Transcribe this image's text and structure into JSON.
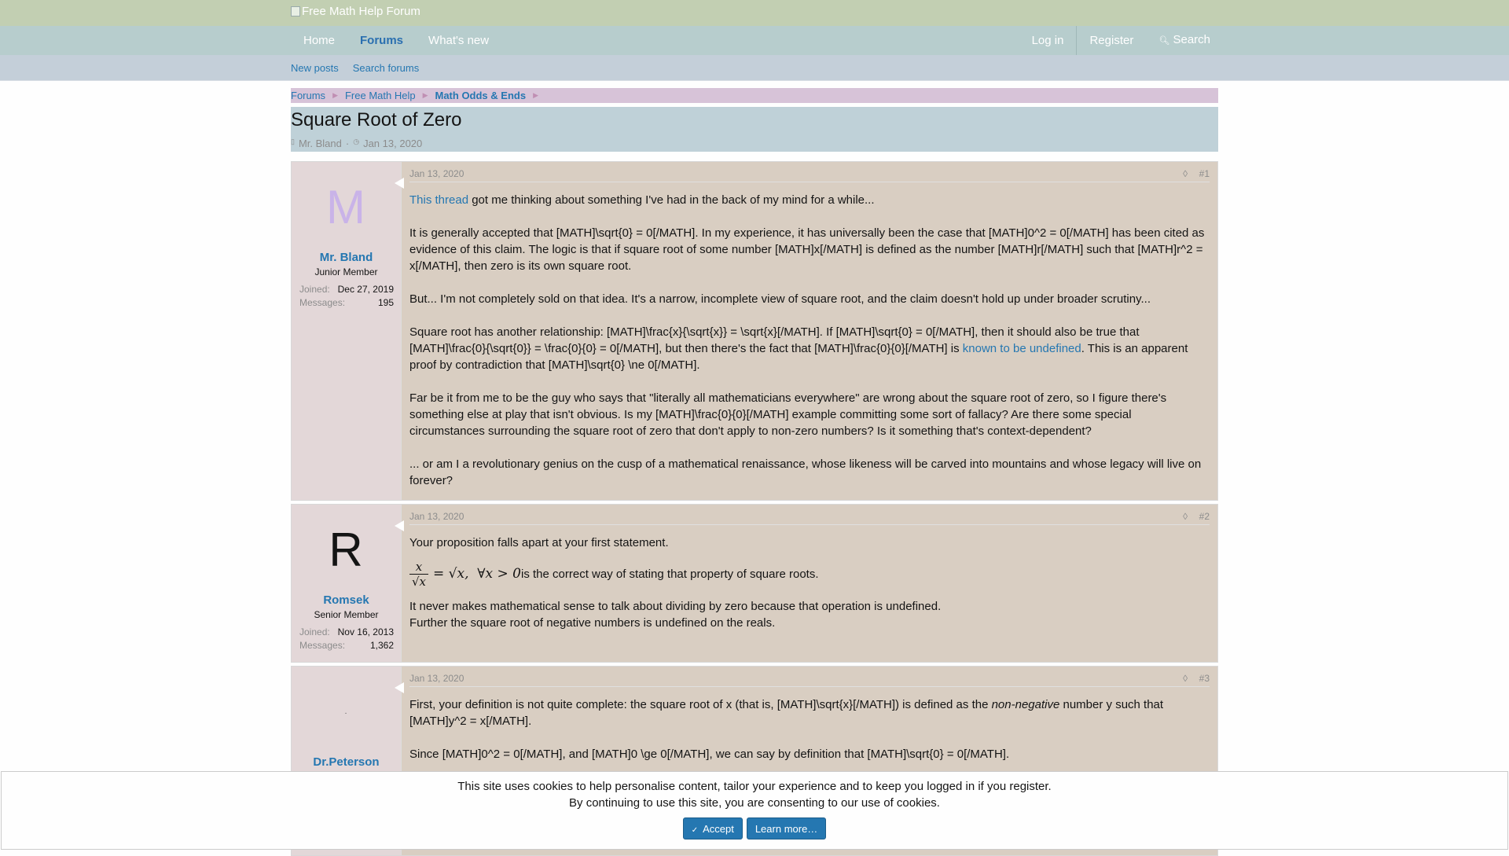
{
  "header": {
    "logo_alt": "Free Math Help Forum"
  },
  "nav": {
    "tabs": [
      {
        "label": "Home"
      },
      {
        "label": "Forums"
      },
      {
        "label": "What's new"
      }
    ],
    "right": {
      "login": "Log in",
      "register": "Register",
      "search": "Search"
    }
  },
  "subnav": {
    "new_posts": "New posts",
    "search_forums": "Search forums"
  },
  "breadcrumb": [
    "Forums",
    "Free Math Help",
    "Math Odds & Ends"
  ],
  "thread": {
    "title": "Square Root of Zero",
    "author": "Mr. Bland",
    "date": "Jan 13, 2020"
  },
  "posts": [
    {
      "date": "Jan 13, 2020",
      "number": "#1",
      "user": {
        "initial": "M",
        "name": "Mr. Bland",
        "title": "Junior Member",
        "joined_label": "Joined:",
        "joined": "Dec 27, 2019",
        "messages_label": "Messages:",
        "messages": "195"
      },
      "p1_link": "This thread",
      "p1_rest": " got me thinking about something I've had in the back of my mind for a while...",
      "p2": "It is generally accepted that [MATH]\\sqrt{0} = 0[/MATH]. In my experience, it has universally been the case that [MATH]0^2 = 0[/MATH] has been cited as evidence of this claim. The logic is that if square root of some number [MATH]x[/MATH] is defined as the number [MATH]r[/MATH] such that [MATH]r^2 = x[/MATH], then zero is its own square root.",
      "p3": "But... I'm not completely sold on that idea. It's a narrow, incomplete view of square root, and the claim doesn't hold up under broader scrutiny...",
      "p4a": "Square root has another relationship: [MATH]\\frac{x}{\\sqrt{x}} = \\sqrt{x}[/MATH]. If [MATH]\\sqrt{0} = 0[/MATH], then it should also be true that [MATH]\\frac{0}{\\sqrt{0}} = \\frac{0}{0} = 0[/MATH], but then there's the fact that [MATH]\\frac{0}{0}[/MATH] is ",
      "p4_link": "known to be undefined",
      "p4b": ". This is an apparent proof by contradiction that [MATH]\\sqrt{0} \\ne 0[/MATH].",
      "p5": "Far be it from me to be the guy who says that \"literally all mathematicians everywhere\" are wrong about the square root of zero, so I figure there's something else at play that isn't obvious. Is my [MATH]\\frac{0}{0}[/MATH] example committing some sort of fallacy? Are there some special circumstances surrounding the square root of zero that don't apply to non-zero numbers? Is it something that's context-dependent?",
      "p6": "... or am I a revolutionary genius on the cusp of a mathematical renaissance, whose likeness will be carved into mountains and whose legacy will live on forever?"
    },
    {
      "date": "Jan 13, 2020",
      "number": "#2",
      "user": {
        "initial": "R",
        "name": "Romsek",
        "title": "Senior Member",
        "joined_label": "Joined:",
        "joined": "Nov 16, 2013",
        "messages_label": "Messages:",
        "messages": "1,362"
      },
      "p1": "Your proposition falls apart at your first statement.",
      "math_num": "x",
      "math_den": "√x",
      "math_rest": "= √x,  ∀x > 0",
      "p2_rest": " is the correct way of stating that property of square roots.",
      "p3": "It never makes mathematical sense to talk about dividing by zero because that operation is undefined.",
      "p4": "Further the square root of negative numbers is undefined on the reals."
    },
    {
      "date": "Jan 13, 2020",
      "number": "#3",
      "user": {
        "name": "Dr.Peterson"
      },
      "p1a": "First, your definition is not quite complete: the square root of x (that is, [MATH]\\sqrt{x}[/MATH]) is defined as the ",
      "p1_em": "non-negative",
      "p1b": " number y such that [MATH]y^2 = x[/MATH].",
      "p2": "Since [MATH]0^2 = 0[/MATH], and [MATH]0 \\ge 0[/MATH], we can say by definition that [MATH]\\sqrt{0} = 0[/MATH]."
    }
  ],
  "cookie": {
    "line1": "This site uses cookies to help personalise content, tailor your experience and to keep you logged in if you register.",
    "line2": "By continuing to use this site, you are consenting to our use of cookies.",
    "accept": "Accept",
    "learn": "Learn more…"
  }
}
